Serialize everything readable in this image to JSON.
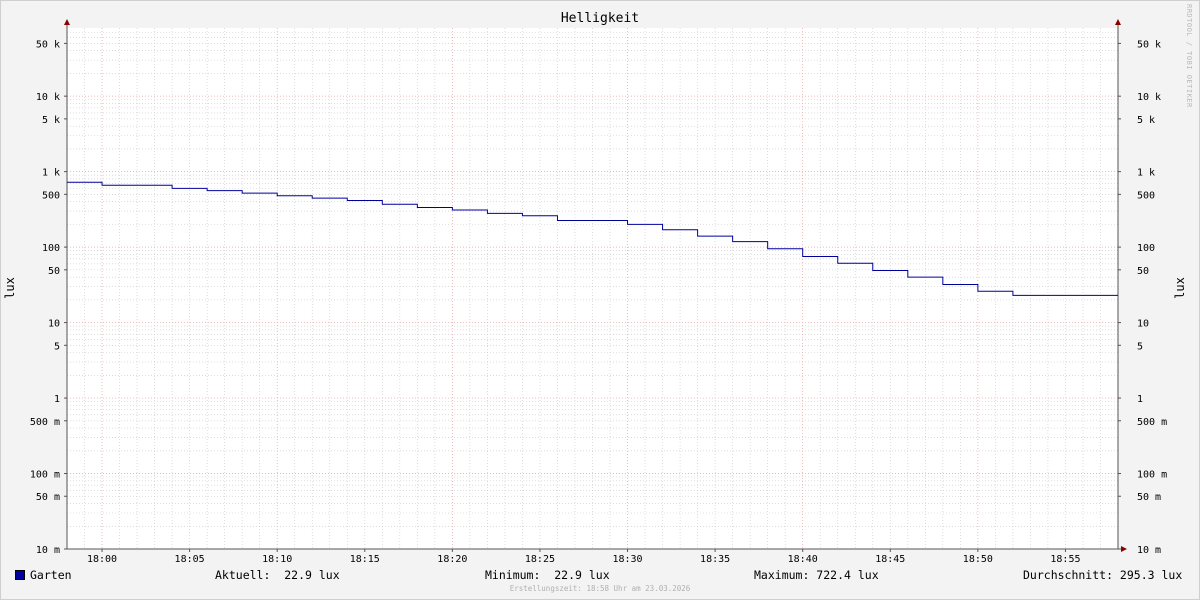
{
  "chart_data": {
    "type": "line",
    "title": "Helligkeit",
    "ylabel": "lux",
    "yscale": "log",
    "ylim": [
      0.01,
      80000
    ],
    "xlim": [
      "17:58",
      "18:58"
    ],
    "y_ticks": [
      {
        "value": 50000,
        "label": "50 k"
      },
      {
        "value": 10000,
        "label": "10 k"
      },
      {
        "value": 5000,
        "label": "5 k"
      },
      {
        "value": 1000,
        "label": "1 k"
      },
      {
        "value": 500,
        "label": "500"
      },
      {
        "value": 100,
        "label": "100"
      },
      {
        "value": 50,
        "label": "50"
      },
      {
        "value": 10,
        "label": "10"
      },
      {
        "value": 5,
        "label": "5"
      },
      {
        "value": 1,
        "label": "1"
      },
      {
        "value": 0.5,
        "label": "500 m"
      },
      {
        "value": 0.1,
        "label": "100 m"
      },
      {
        "value": 0.05,
        "label": "50 m"
      },
      {
        "value": 0.01,
        "label": "10 m"
      }
    ],
    "x_ticks": [
      "18:00",
      "18:05",
      "18:10",
      "18:15",
      "18:20",
      "18:25",
      "18:30",
      "18:35",
      "18:40",
      "18:45",
      "18:50",
      "18:55"
    ],
    "grid": true,
    "series": [
      {
        "name": "Garten",
        "color": "#00009c",
        "step": true,
        "x": [
          "17:58",
          "18:00",
          "18:04",
          "18:06",
          "18:08",
          "18:10",
          "18:12",
          "18:14",
          "18:16",
          "18:18",
          "18:20",
          "18:22",
          "18:24",
          "18:26",
          "18:30",
          "18:32",
          "18:34",
          "18:36",
          "18:38",
          "18:40",
          "18:42",
          "18:44",
          "18:46",
          "18:48",
          "18:50",
          "18:52",
          "18:54",
          "18:58"
        ],
        "values": [
          722.4,
          660,
          600,
          560,
          520,
          480,
          445,
          415,
          370,
          335,
          310,
          280,
          260,
          225,
          200,
          170,
          140,
          118,
          95,
          75,
          61,
          49,
          40,
          32,
          26,
          22.9,
          22.9,
          22.9
        ]
      }
    ]
  },
  "legend": {
    "series_name": "Garten",
    "current": "Aktuell:  22.9 lux",
    "minimum": "Minimum:  22.9 lux",
    "maximum": "Maximum: 722.4 lux",
    "average": "Durchschnitt: 295.3 lux"
  },
  "watermark": "RRDTOOL / TOBI OETIKER",
  "footer": "Erstellungszeit: 18:58 Uhr am 23.03.2026",
  "colors": {
    "series": "#00009c",
    "major_grid": "#e8a0a0",
    "minor_grid": "#c8c8c8",
    "axis_arrow": "#8b0000",
    "background": "#f3f3f3"
  }
}
